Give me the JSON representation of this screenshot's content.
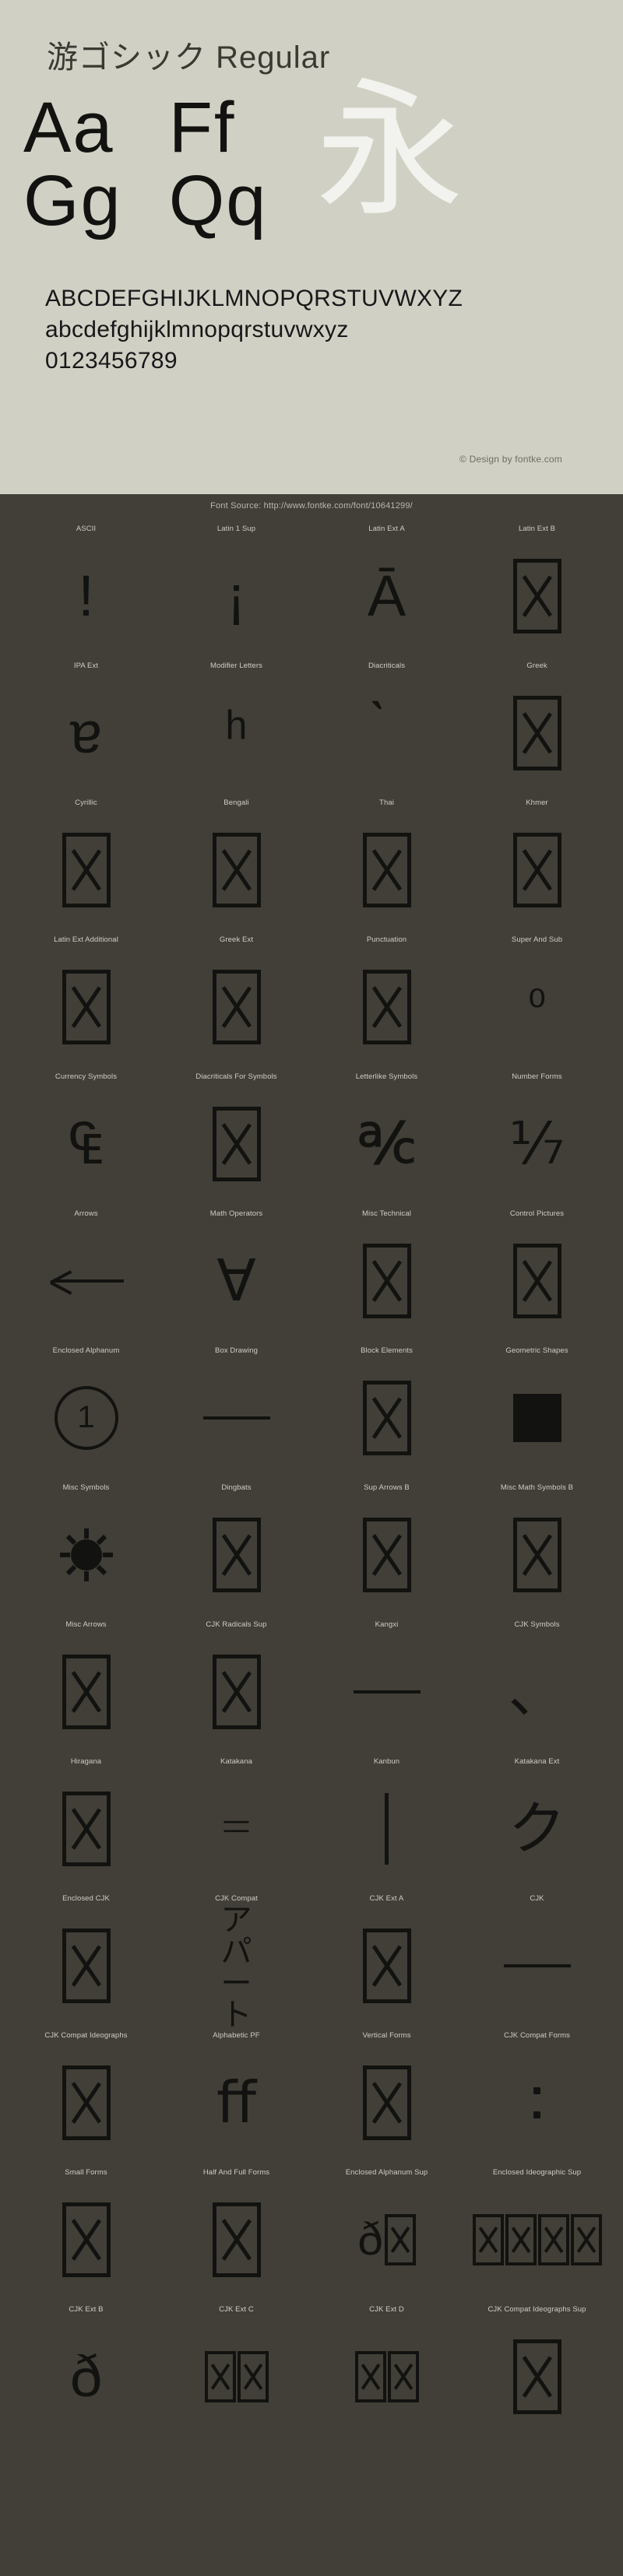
{
  "page": {
    "title": "游ゴシック Regular",
    "background_light": "#d0d0c4",
    "background_dark": "#413f37",
    "glyph_color": "#121210"
  },
  "specimen": {
    "pairs": [
      {
        "text": "Aa"
      },
      {
        "text": "Ff"
      },
      {
        "text": "Gg"
      },
      {
        "text": "Qq"
      }
    ],
    "kanji": "永",
    "uppercase": "ABCDEFGHIJKLMNOPQRSTUVWXYZ",
    "lowercase": "abcdefghijklmnopqrstuvwxyz",
    "digits": "0123456789",
    "credit": "© Design by fontke.com"
  },
  "footer": {
    "font_source": "Font Source: http://www.fontke.com/font/10641299/"
  },
  "blocks": [
    {
      "label": "ASCII",
      "glyph": "!",
      "kind": "text",
      "size": "lg"
    },
    {
      "label": "Latin 1 Sup",
      "glyph": "¡",
      "kind": "text",
      "size": "lg"
    },
    {
      "label": "Latin Ext A",
      "glyph": "Ā",
      "kind": "text",
      "size": "lg"
    },
    {
      "label": "Latin Ext B",
      "glyph": "",
      "kind": "notdef"
    },
    {
      "label": "IPA Ext",
      "glyph": "ɐ",
      "kind": "text",
      "size": "lg"
    },
    {
      "label": "Modifier Letters",
      "glyph": "ʰ",
      "kind": "text",
      "size": "lg"
    },
    {
      "label": "Diacriticals",
      "glyph": "̀",
      "kind": "text",
      "size": "lg"
    },
    {
      "label": "Greek",
      "glyph": "",
      "kind": "notdef"
    },
    {
      "label": "Cyrillic",
      "glyph": "",
      "kind": "notdef"
    },
    {
      "label": "Bengali",
      "glyph": "",
      "kind": "notdef"
    },
    {
      "label": "Thai",
      "glyph": "",
      "kind": "notdef"
    },
    {
      "label": "Khmer",
      "glyph": "",
      "kind": "notdef"
    },
    {
      "label": "Latin Ext Additional",
      "glyph": "",
      "kind": "notdef"
    },
    {
      "label": "Greek Ext",
      "glyph": "",
      "kind": "notdef"
    },
    {
      "label": "Punctuation",
      "glyph": "",
      "kind": "notdef"
    },
    {
      "label": "Super And Sub",
      "glyph": "⁰",
      "kind": "text",
      "size": "sm"
    },
    {
      "label": "Currency Symbols",
      "glyph": "₠",
      "kind": "text",
      "size": "lg"
    },
    {
      "label": "Diacriticals For Symbols",
      "glyph": "",
      "kind": "notdef"
    },
    {
      "label": "Letterlike Symbols",
      "glyph": "℀",
      "kind": "text",
      "size": "lg"
    },
    {
      "label": "Number Forms",
      "glyph": "⅐",
      "kind": "text",
      "size": "lg"
    },
    {
      "label": "Arrows",
      "glyph": "←",
      "kind": "arrow"
    },
    {
      "label": "Math Operators",
      "glyph": "∀",
      "kind": "text",
      "size": "lg"
    },
    {
      "label": "Misc Technical",
      "glyph": "",
      "kind": "notdef"
    },
    {
      "label": "Control Pictures",
      "glyph": "",
      "kind": "notdef"
    },
    {
      "label": "Enclosed Alphanum",
      "glyph": "①",
      "kind": "circle"
    },
    {
      "label": "Box Drawing",
      "glyph": "─",
      "kind": "hline"
    },
    {
      "label": "Block Elements",
      "glyph": "",
      "kind": "notdef"
    },
    {
      "label": "Geometric Shapes",
      "glyph": "■",
      "kind": "square"
    },
    {
      "label": "Misc Symbols",
      "glyph": "☀",
      "kind": "sun"
    },
    {
      "label": "Dingbats",
      "glyph": "",
      "kind": "notdef"
    },
    {
      "label": "Sup Arrows B",
      "glyph": "",
      "kind": "notdef"
    },
    {
      "label": "Misc Math Symbols B",
      "glyph": "",
      "kind": "notdef"
    },
    {
      "label": "Misc Arrows",
      "glyph": "",
      "kind": "notdef"
    },
    {
      "label": "CJK Radicals Sup",
      "glyph": "",
      "kind": "notdef"
    },
    {
      "label": "Kangxi",
      "glyph": "一",
      "kind": "hline"
    },
    {
      "label": "CJK Symbols",
      "glyph": "、",
      "kind": "text",
      "size": "lg"
    },
    {
      "label": "Hiragana",
      "glyph": "",
      "kind": "notdef"
    },
    {
      "label": "Katakana",
      "glyph": "゠",
      "kind": "text",
      "size": "lg"
    },
    {
      "label": "Kanbun",
      "glyph": "㆐",
      "kind": "vbar"
    },
    {
      "label": "Katakana Ext",
      "glyph": "ク",
      "kind": "text",
      "size": "lg"
    },
    {
      "label": "Enclosed CJK",
      "glyph": "",
      "kind": "notdef"
    },
    {
      "label": "CJK Compat",
      "glyph": "アパート",
      "kind": "cjkstack"
    },
    {
      "label": "CJK Ext A",
      "glyph": "",
      "kind": "notdef"
    },
    {
      "label": "CJK",
      "glyph": "一",
      "kind": "hline"
    },
    {
      "label": "CJK Compat Ideographs",
      "glyph": "",
      "kind": "notdef"
    },
    {
      "label": "Alphabetic PF",
      "glyph": "ﬀ",
      "kind": "text",
      "size": "lg"
    },
    {
      "label": "Vertical Forms",
      "glyph": "",
      "kind": "notdef"
    },
    {
      "label": "CJK Compat Forms",
      "glyph": "︓",
      "kind": "dots"
    },
    {
      "label": "Small Forms",
      "glyph": "",
      "kind": "notdef"
    },
    {
      "label": "Half And Full Forms",
      "glyph": "",
      "kind": "notdef"
    },
    {
      "label": "Enclosed Alphanum Sup",
      "glyph": "ð",
      "kind": "mixed-one"
    },
    {
      "label": "Enclosed Ideographic Sup",
      "glyph": "",
      "kind": "mixed-many"
    },
    {
      "label": "CJK Ext B",
      "glyph": "ð",
      "kind": "text",
      "size": "lg"
    },
    {
      "label": "CJK Ext C",
      "glyph": "",
      "kind": "mixed-pair"
    },
    {
      "label": "CJK Ext D",
      "glyph": "",
      "kind": "mixed-pair"
    },
    {
      "label": "CJK Compat Ideographs Sup",
      "glyph": "",
      "kind": "notdef"
    }
  ]
}
